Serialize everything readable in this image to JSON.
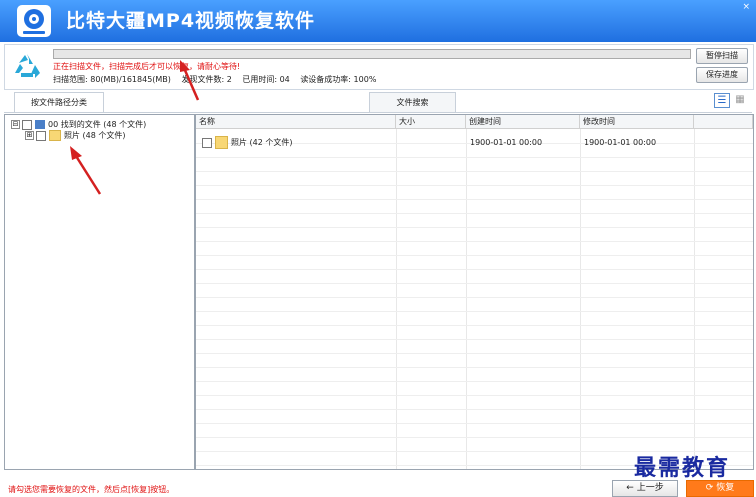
{
  "app": {
    "title": "比特大疆MP4视频恢复软件",
    "close_label": "×"
  },
  "status": {
    "message": "正在扫描文件，扫描完成后才可以恢复，请耐心等待!",
    "scan_range": "扫描范围: 80(MB)/161845(MB)",
    "found_files": "发现文件数: 2",
    "elapsed": "已用时间: 04",
    "read_success": "读设备成功率: 100%",
    "progress_fraction": 0.0
  },
  "buttons": {
    "pause_scan": "暂停扫描",
    "save_progress": "保存进度",
    "prev": "← 上一步",
    "recover": "⟳ 恢复"
  },
  "tabs": {
    "by_path": "按文件路径分类",
    "search": "文件搜索"
  },
  "tree": [
    {
      "expander": "⊟",
      "label": "00 找到的文件  (48 个文件)"
    },
    {
      "expander": "⊞",
      "label": "照片   (48 个文件)"
    }
  ],
  "table": {
    "headers": [
      "名称",
      "大小",
      "创建时间",
      "修改时间"
    ],
    "rows": [
      {
        "name": "照片   (42 个文件)",
        "size": "",
        "created": "1900-01-01 00:00",
        "modified": "1900-01-01 00:00"
      }
    ]
  },
  "footer": {
    "hint": "请勾选您需要恢复的文件，然后点[恢复]按钮。"
  },
  "watermark": "最需教育",
  "colors": {
    "title_bar": "#1f6fe0",
    "error_text": "#e01010",
    "recover_button": "#ff7a1a",
    "arrow": "#d42020"
  }
}
